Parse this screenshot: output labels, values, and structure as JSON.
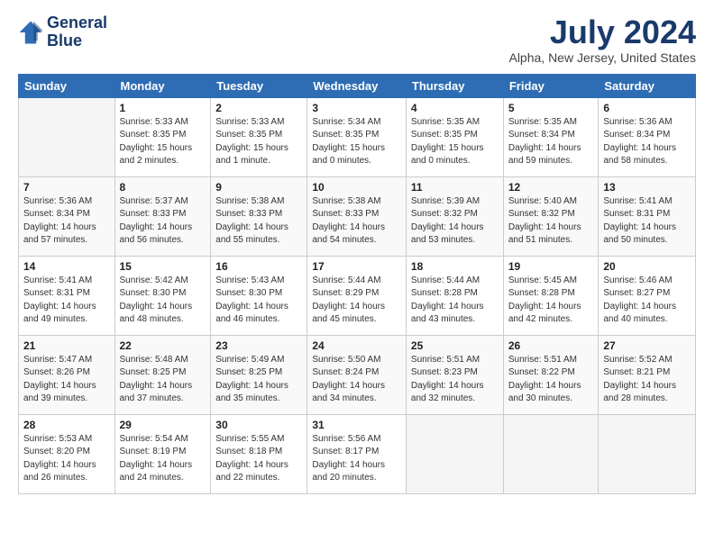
{
  "logo": {
    "line1": "General",
    "line2": "Blue"
  },
  "title": "July 2024",
  "subtitle": "Alpha, New Jersey, United States",
  "days_header": [
    "Sunday",
    "Monday",
    "Tuesday",
    "Wednesday",
    "Thursday",
    "Friday",
    "Saturday"
  ],
  "weeks": [
    [
      {
        "day": "",
        "info": ""
      },
      {
        "day": "1",
        "info": "Sunrise: 5:33 AM\nSunset: 8:35 PM\nDaylight: 15 hours\nand 2 minutes."
      },
      {
        "day": "2",
        "info": "Sunrise: 5:33 AM\nSunset: 8:35 PM\nDaylight: 15 hours\nand 1 minute."
      },
      {
        "day": "3",
        "info": "Sunrise: 5:34 AM\nSunset: 8:35 PM\nDaylight: 15 hours\nand 0 minutes."
      },
      {
        "day": "4",
        "info": "Sunrise: 5:35 AM\nSunset: 8:35 PM\nDaylight: 15 hours\nand 0 minutes."
      },
      {
        "day": "5",
        "info": "Sunrise: 5:35 AM\nSunset: 8:34 PM\nDaylight: 14 hours\nand 59 minutes."
      },
      {
        "day": "6",
        "info": "Sunrise: 5:36 AM\nSunset: 8:34 PM\nDaylight: 14 hours\nand 58 minutes."
      }
    ],
    [
      {
        "day": "7",
        "info": "Sunrise: 5:36 AM\nSunset: 8:34 PM\nDaylight: 14 hours\nand 57 minutes."
      },
      {
        "day": "8",
        "info": "Sunrise: 5:37 AM\nSunset: 8:33 PM\nDaylight: 14 hours\nand 56 minutes."
      },
      {
        "day": "9",
        "info": "Sunrise: 5:38 AM\nSunset: 8:33 PM\nDaylight: 14 hours\nand 55 minutes."
      },
      {
        "day": "10",
        "info": "Sunrise: 5:38 AM\nSunset: 8:33 PM\nDaylight: 14 hours\nand 54 minutes."
      },
      {
        "day": "11",
        "info": "Sunrise: 5:39 AM\nSunset: 8:32 PM\nDaylight: 14 hours\nand 53 minutes."
      },
      {
        "day": "12",
        "info": "Sunrise: 5:40 AM\nSunset: 8:32 PM\nDaylight: 14 hours\nand 51 minutes."
      },
      {
        "day": "13",
        "info": "Sunrise: 5:41 AM\nSunset: 8:31 PM\nDaylight: 14 hours\nand 50 minutes."
      }
    ],
    [
      {
        "day": "14",
        "info": "Sunrise: 5:41 AM\nSunset: 8:31 PM\nDaylight: 14 hours\nand 49 minutes."
      },
      {
        "day": "15",
        "info": "Sunrise: 5:42 AM\nSunset: 8:30 PM\nDaylight: 14 hours\nand 48 minutes."
      },
      {
        "day": "16",
        "info": "Sunrise: 5:43 AM\nSunset: 8:30 PM\nDaylight: 14 hours\nand 46 minutes."
      },
      {
        "day": "17",
        "info": "Sunrise: 5:44 AM\nSunset: 8:29 PM\nDaylight: 14 hours\nand 45 minutes."
      },
      {
        "day": "18",
        "info": "Sunrise: 5:44 AM\nSunset: 8:28 PM\nDaylight: 14 hours\nand 43 minutes."
      },
      {
        "day": "19",
        "info": "Sunrise: 5:45 AM\nSunset: 8:28 PM\nDaylight: 14 hours\nand 42 minutes."
      },
      {
        "day": "20",
        "info": "Sunrise: 5:46 AM\nSunset: 8:27 PM\nDaylight: 14 hours\nand 40 minutes."
      }
    ],
    [
      {
        "day": "21",
        "info": "Sunrise: 5:47 AM\nSunset: 8:26 PM\nDaylight: 14 hours\nand 39 minutes."
      },
      {
        "day": "22",
        "info": "Sunrise: 5:48 AM\nSunset: 8:25 PM\nDaylight: 14 hours\nand 37 minutes."
      },
      {
        "day": "23",
        "info": "Sunrise: 5:49 AM\nSunset: 8:25 PM\nDaylight: 14 hours\nand 35 minutes."
      },
      {
        "day": "24",
        "info": "Sunrise: 5:50 AM\nSunset: 8:24 PM\nDaylight: 14 hours\nand 34 minutes."
      },
      {
        "day": "25",
        "info": "Sunrise: 5:51 AM\nSunset: 8:23 PM\nDaylight: 14 hours\nand 32 minutes."
      },
      {
        "day": "26",
        "info": "Sunrise: 5:51 AM\nSunset: 8:22 PM\nDaylight: 14 hours\nand 30 minutes."
      },
      {
        "day": "27",
        "info": "Sunrise: 5:52 AM\nSunset: 8:21 PM\nDaylight: 14 hours\nand 28 minutes."
      }
    ],
    [
      {
        "day": "28",
        "info": "Sunrise: 5:53 AM\nSunset: 8:20 PM\nDaylight: 14 hours\nand 26 minutes."
      },
      {
        "day": "29",
        "info": "Sunrise: 5:54 AM\nSunset: 8:19 PM\nDaylight: 14 hours\nand 24 minutes."
      },
      {
        "day": "30",
        "info": "Sunrise: 5:55 AM\nSunset: 8:18 PM\nDaylight: 14 hours\nand 22 minutes."
      },
      {
        "day": "31",
        "info": "Sunrise: 5:56 AM\nSunset: 8:17 PM\nDaylight: 14 hours\nand 20 minutes."
      },
      {
        "day": "",
        "info": ""
      },
      {
        "day": "",
        "info": ""
      },
      {
        "day": "",
        "info": ""
      }
    ]
  ]
}
